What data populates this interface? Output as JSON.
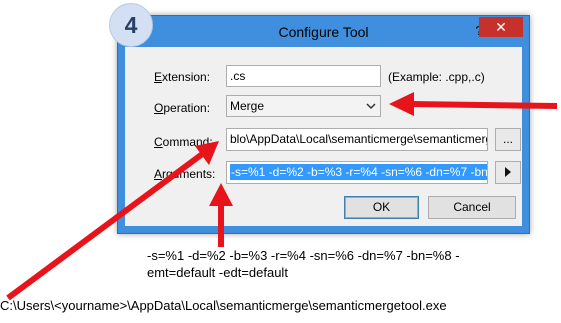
{
  "step_number": "4",
  "dialog": {
    "title": "Configure Tool",
    "help_label": "?",
    "close_label": "✕",
    "extension": {
      "label_prefix": "",
      "label_access": "E",
      "label_rest": "xtension:",
      "value": ".cs",
      "example": "(Example: .cpp,.c)"
    },
    "operation": {
      "label_access": "O",
      "label_rest": "peration:",
      "value": "Merge",
      "chevron_icon": "chevron-down-icon"
    },
    "command": {
      "label_access": "C",
      "label_rest": "ommand:",
      "value": "blo\\AppData\\Local\\semanticmerge\\semanticmerge",
      "browse_label": "..."
    },
    "arguments": {
      "label_access": "A",
      "label_rest": "rguments:",
      "value": "-s=%1 -d=%2 -b=%3 -r=%4 -sn=%6 -dn=%7 -bn",
      "menu_icon": "triangle-right-icon"
    },
    "ok_label": "OK",
    "cancel_label": "Cancel"
  },
  "annotations": {
    "arguments_line1": "-s=%1 -d=%2 -b=%3 -r=%4 -sn=%6 -dn=%7 -bn=%8 -",
    "arguments_line2": "emt=default -edt=default",
    "command_path": "C:\\Users\\<yourname>\\AppData\\Local\\semanticmerge\\semanticmergetool.exe",
    "arrow_color": "#e8141b"
  }
}
